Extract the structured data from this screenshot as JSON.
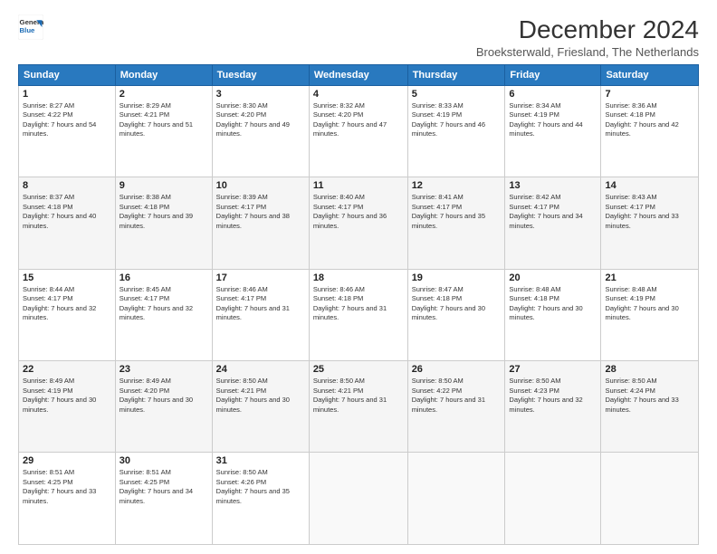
{
  "logo": {
    "text_general": "General",
    "text_blue": "Blue"
  },
  "header": {
    "title": "December 2024",
    "subtitle": "Broeksterwald, Friesland, The Netherlands"
  },
  "days_of_week": [
    "Sunday",
    "Monday",
    "Tuesday",
    "Wednesday",
    "Thursday",
    "Friday",
    "Saturday"
  ],
  "weeks": [
    [
      {
        "day": 1,
        "sunrise": "8:27 AM",
        "sunset": "4:22 PM",
        "daylight": "7 hours and 54 minutes."
      },
      {
        "day": 2,
        "sunrise": "8:29 AM",
        "sunset": "4:21 PM",
        "daylight": "7 hours and 51 minutes."
      },
      {
        "day": 3,
        "sunrise": "8:30 AM",
        "sunset": "4:20 PM",
        "daylight": "7 hours and 49 minutes."
      },
      {
        "day": 4,
        "sunrise": "8:32 AM",
        "sunset": "4:20 PM",
        "daylight": "7 hours and 47 minutes."
      },
      {
        "day": 5,
        "sunrise": "8:33 AM",
        "sunset": "4:19 PM",
        "daylight": "7 hours and 46 minutes."
      },
      {
        "day": 6,
        "sunrise": "8:34 AM",
        "sunset": "4:19 PM",
        "daylight": "7 hours and 44 minutes."
      },
      {
        "day": 7,
        "sunrise": "8:36 AM",
        "sunset": "4:18 PM",
        "daylight": "7 hours and 42 minutes."
      }
    ],
    [
      {
        "day": 8,
        "sunrise": "8:37 AM",
        "sunset": "4:18 PM",
        "daylight": "7 hours and 40 minutes."
      },
      {
        "day": 9,
        "sunrise": "8:38 AM",
        "sunset": "4:18 PM",
        "daylight": "7 hours and 39 minutes."
      },
      {
        "day": 10,
        "sunrise": "8:39 AM",
        "sunset": "4:17 PM",
        "daylight": "7 hours and 38 minutes."
      },
      {
        "day": 11,
        "sunrise": "8:40 AM",
        "sunset": "4:17 PM",
        "daylight": "7 hours and 36 minutes."
      },
      {
        "day": 12,
        "sunrise": "8:41 AM",
        "sunset": "4:17 PM",
        "daylight": "7 hours and 35 minutes."
      },
      {
        "day": 13,
        "sunrise": "8:42 AM",
        "sunset": "4:17 PM",
        "daylight": "7 hours and 34 minutes."
      },
      {
        "day": 14,
        "sunrise": "8:43 AM",
        "sunset": "4:17 PM",
        "daylight": "7 hours and 33 minutes."
      }
    ],
    [
      {
        "day": 15,
        "sunrise": "8:44 AM",
        "sunset": "4:17 PM",
        "daylight": "7 hours and 32 minutes."
      },
      {
        "day": 16,
        "sunrise": "8:45 AM",
        "sunset": "4:17 PM",
        "daylight": "7 hours and 32 minutes."
      },
      {
        "day": 17,
        "sunrise": "8:46 AM",
        "sunset": "4:17 PM",
        "daylight": "7 hours and 31 minutes."
      },
      {
        "day": 18,
        "sunrise": "8:46 AM",
        "sunset": "4:18 PM",
        "daylight": "7 hours and 31 minutes."
      },
      {
        "day": 19,
        "sunrise": "8:47 AM",
        "sunset": "4:18 PM",
        "daylight": "7 hours and 30 minutes."
      },
      {
        "day": 20,
        "sunrise": "8:48 AM",
        "sunset": "4:18 PM",
        "daylight": "7 hours and 30 minutes."
      },
      {
        "day": 21,
        "sunrise": "8:48 AM",
        "sunset": "4:19 PM",
        "daylight": "7 hours and 30 minutes."
      }
    ],
    [
      {
        "day": 22,
        "sunrise": "8:49 AM",
        "sunset": "4:19 PM",
        "daylight": "7 hours and 30 minutes."
      },
      {
        "day": 23,
        "sunrise": "8:49 AM",
        "sunset": "4:20 PM",
        "daylight": "7 hours and 30 minutes."
      },
      {
        "day": 24,
        "sunrise": "8:50 AM",
        "sunset": "4:21 PM",
        "daylight": "7 hours and 30 minutes."
      },
      {
        "day": 25,
        "sunrise": "8:50 AM",
        "sunset": "4:21 PM",
        "daylight": "7 hours and 31 minutes."
      },
      {
        "day": 26,
        "sunrise": "8:50 AM",
        "sunset": "4:22 PM",
        "daylight": "7 hours and 31 minutes."
      },
      {
        "day": 27,
        "sunrise": "8:50 AM",
        "sunset": "4:23 PM",
        "daylight": "7 hours and 32 minutes."
      },
      {
        "day": 28,
        "sunrise": "8:50 AM",
        "sunset": "4:24 PM",
        "daylight": "7 hours and 33 minutes."
      }
    ],
    [
      {
        "day": 29,
        "sunrise": "8:51 AM",
        "sunset": "4:25 PM",
        "daylight": "7 hours and 33 minutes."
      },
      {
        "day": 30,
        "sunrise": "8:51 AM",
        "sunset": "4:25 PM",
        "daylight": "7 hours and 34 minutes."
      },
      {
        "day": 31,
        "sunrise": "8:50 AM",
        "sunset": "4:26 PM",
        "daylight": "7 hours and 35 minutes."
      },
      null,
      null,
      null,
      null
    ]
  ],
  "labels": {
    "sunrise": "Sunrise:",
    "sunset": "Sunset:",
    "daylight": "Daylight:"
  }
}
